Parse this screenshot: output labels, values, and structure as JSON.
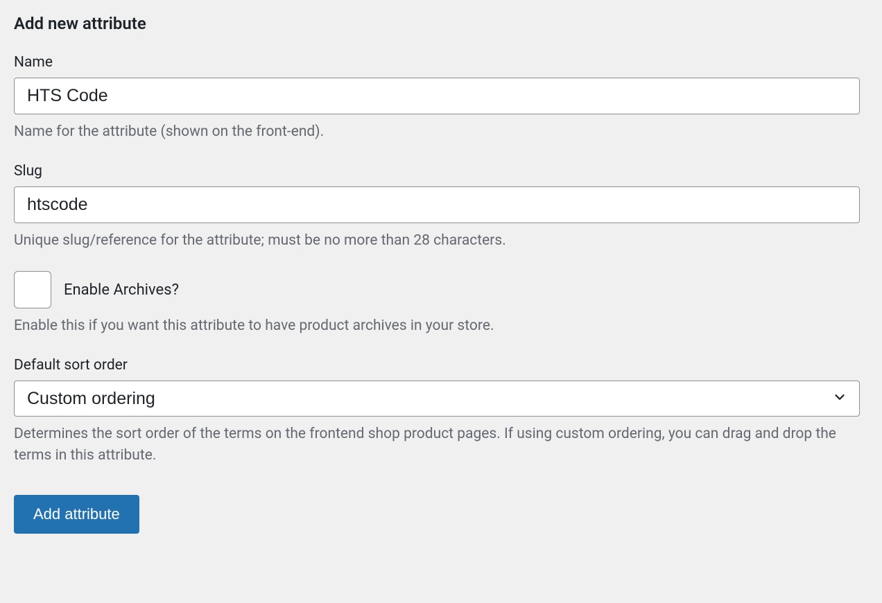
{
  "heading": "Add new attribute",
  "fields": {
    "name": {
      "label": "Name",
      "value": "HTS Code",
      "help": "Name for the attribute (shown on the front-end)."
    },
    "slug": {
      "label": "Slug",
      "value": "htscode",
      "help": "Unique slug/reference for the attribute; must be no more than 28 characters."
    },
    "enable_archives": {
      "label": "Enable Archives?",
      "checked": false,
      "help": "Enable this if you want this attribute to have product archives in your store."
    },
    "sort_order": {
      "label": "Default sort order",
      "selected": "Custom ordering",
      "help": "Determines the sort order of the terms on the frontend shop product pages. If using custom ordering, you can drag and drop the terms in this attribute."
    }
  },
  "submit_label": "Add attribute"
}
